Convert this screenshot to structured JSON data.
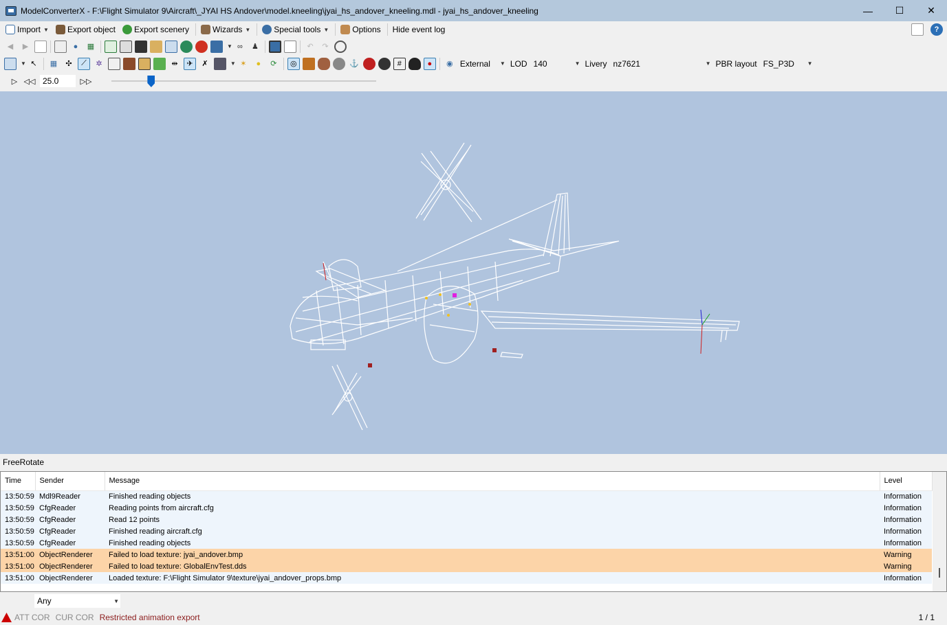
{
  "window": {
    "title": "ModelConverterX - F:\\Flight Simulator 9\\Aircraft\\_JYAI HS Andover\\model.kneeling\\jyai_hs_andover_kneeling.mdl - jyai_hs_andover_kneeling",
    "minimize": "—",
    "maximize": "☐",
    "close": "✕"
  },
  "menu": {
    "import": "Import",
    "export_object": "Export object",
    "export_scenery": "Export scenery",
    "wizards": "Wizards",
    "special_tools": "Special tools",
    "options": "Options",
    "hide_event_log": "Hide event log"
  },
  "toolbar3": {
    "view_label": "External",
    "lod_label": "LOD",
    "lod_value": "140",
    "livery_label": "Livery",
    "livery_value": "nz7621",
    "pbr_label": "PBR layout",
    "pbr_value": "FS_P3D"
  },
  "anim": {
    "speed": "25.0",
    "slider_position": 0.14
  },
  "status_mode": "FreeRotate",
  "log": {
    "columns": {
      "time": "Time",
      "sender": "Sender",
      "message": "Message",
      "level": "Level"
    },
    "rows": [
      {
        "time": "13:50:59",
        "sender": "Mdl9Reader",
        "message": "Finished reading objects",
        "level": "Information"
      },
      {
        "time": "13:50:59",
        "sender": "CfgReader",
        "message": "Reading points from aircraft.cfg",
        "level": "Information"
      },
      {
        "time": "13:50:59",
        "sender": "CfgReader",
        "message": "Read 12 points",
        "level": "Information"
      },
      {
        "time": "13:50:59",
        "sender": "CfgReader",
        "message": "Finished reading aircraft.cfg",
        "level": "Information"
      },
      {
        "time": "13:50:59",
        "sender": "CfgReader",
        "message": "Finished reading objects",
        "level": "Information"
      },
      {
        "time": "13:51:00",
        "sender": "ObjectRenderer",
        "message": "Failed to load texture: jyai_andover.bmp",
        "level": "Warning"
      },
      {
        "time": "13:51:00",
        "sender": "ObjectRenderer",
        "message": "Failed to load texture: GlobalEnvTest.dds",
        "level": "Warning"
      },
      {
        "time": "13:51:00",
        "sender": "ObjectRenderer",
        "message": "Loaded texture: F:\\Flight Simulator 9\\texture\\jyai_andover_props.bmp",
        "level": "Information"
      }
    ]
  },
  "filter": {
    "value": "Any"
  },
  "status": {
    "att_cor": "ATT COR",
    "cur_cor": "CUR COR",
    "warning": "Restricted animation export",
    "page": "1 / 1"
  },
  "colors": {
    "viewport": "#b0c4de",
    "warning_row": "#fcd4a8",
    "info_row": "#eef5fc",
    "titlebar": "#b4c8dc"
  }
}
